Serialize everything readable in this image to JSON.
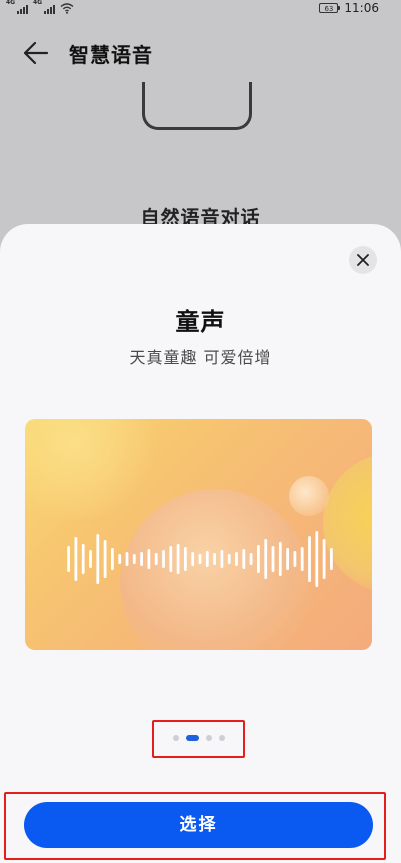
{
  "status_bar": {
    "signal_1_label": "4G",
    "signal_2_label": "4G",
    "battery_level": "63",
    "time": "11:06"
  },
  "header": {
    "title": "智慧语音",
    "back_icon": "arrow-left-icon"
  },
  "background": {
    "caption": "自然语音对话"
  },
  "sheet": {
    "close_icon": "close-icon",
    "voice_name": "童声",
    "voice_description": "天真童趣 可爱倍增",
    "pager": {
      "page_count": 4,
      "active_index": 1
    },
    "select_button_label": "选择"
  },
  "colors": {
    "accent": "#0a59f0",
    "pager_active": "#1f5fe0",
    "highlight": "#e41d1d",
    "card_gradient_start": "#f9d873",
    "card_gradient_end": "#f4ab7c"
  }
}
